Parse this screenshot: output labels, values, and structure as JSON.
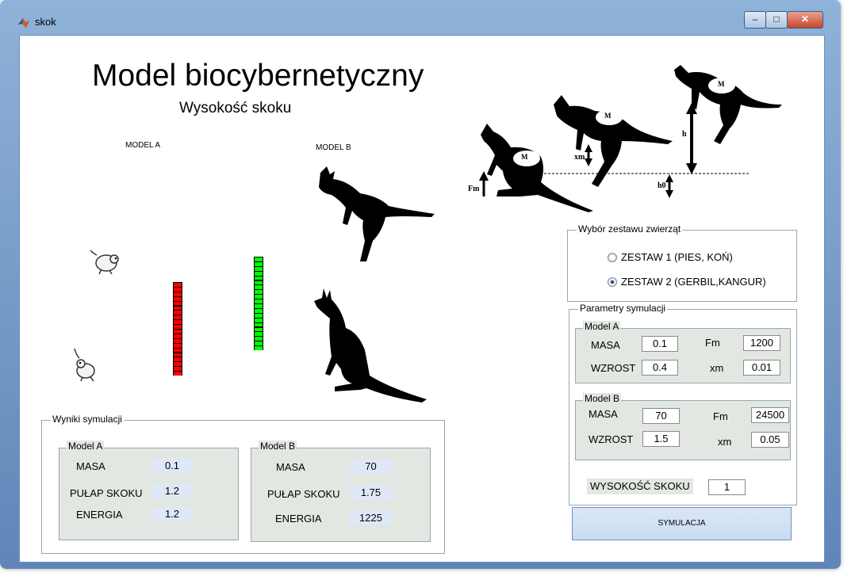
{
  "window": {
    "title": "skok"
  },
  "main": {
    "title": "Model biocybernetyczny",
    "subtitle": "Wysokość skoku",
    "model_a_label": "MODEL A",
    "model_b_label": "MODEL B",
    "bar_a": {
      "segments": 20,
      "lit": 20,
      "color": "#ff0000"
    },
    "bar_b": {
      "segments": 20,
      "lit": 20,
      "color": "#00ff00"
    }
  },
  "diagram": {
    "mass_label": "M",
    "fm_label": "Fm",
    "xm_label": "xm",
    "h0_label": "h0",
    "h_label": "h"
  },
  "animal_set": {
    "title": "Wybór zestawu zwierząt",
    "options": [
      {
        "label": "ZESTAW 1 (PIES, KOŃ)",
        "selected": false
      },
      {
        "label": "ZESTAW 2 (GERBIL,KANGUR)",
        "selected": true
      }
    ]
  },
  "params": {
    "title": "Parametry symulacji",
    "model_a": {
      "title": "Model A",
      "masa_label": "MASA",
      "masa": "0.1",
      "fm_label": "Fm",
      "fm": "1200",
      "wzrost_label": "WZROST",
      "wzrost": "0.4",
      "xm_label": "xm",
      "xm": "0.01"
    },
    "model_b": {
      "title": "Model B",
      "masa_label": "MASA",
      "masa": "70",
      "fm_label": "Fm",
      "fm": "24500",
      "wzrost_label": "WZROST",
      "wzrost": "1.5",
      "xm_label": "xm",
      "xm": "0.05"
    },
    "jump_label": "WYSOKOŚĆ SKOKU",
    "jump_value": "1"
  },
  "results": {
    "title": "Wyniki symulacji",
    "model_a": {
      "title": "Model A",
      "masa_label": "MASA",
      "masa": "0.1",
      "pulap_label": "PUŁAP SKOKU",
      "pulap": "1.2",
      "energia_label": "ENERGIA",
      "energia": "1.2"
    },
    "model_b": {
      "title": "Model B",
      "masa_label": "MASA",
      "masa": "70",
      "pulap_label": "PUŁAP SKOKU",
      "pulap": "1.75",
      "energia_label": "ENERGIA",
      "energia": "1225"
    }
  },
  "buttons": {
    "simulate": "SYMULACJA",
    "minimize": "–",
    "maximize": "□",
    "close": "✕"
  }
}
